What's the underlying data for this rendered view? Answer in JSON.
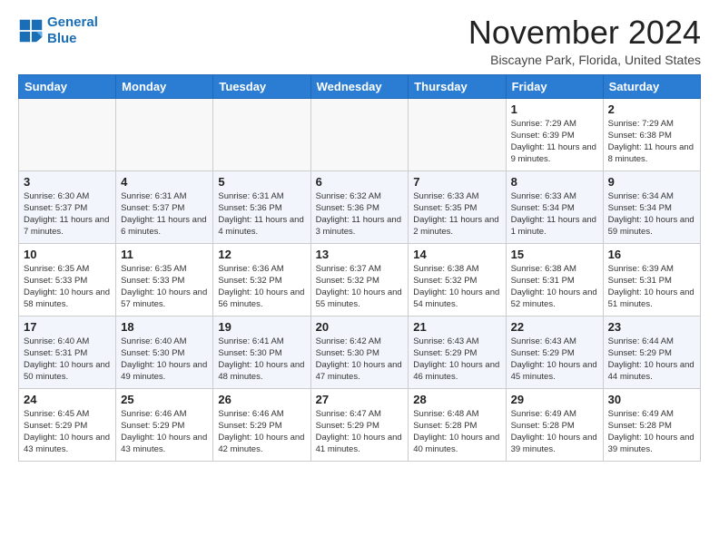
{
  "header": {
    "logo_line1": "General",
    "logo_line2": "Blue",
    "month": "November 2024",
    "location": "Biscayne Park, Florida, United States"
  },
  "days_of_week": [
    "Sunday",
    "Monday",
    "Tuesday",
    "Wednesday",
    "Thursday",
    "Friday",
    "Saturday"
  ],
  "weeks": [
    [
      {
        "day": "",
        "info": ""
      },
      {
        "day": "",
        "info": ""
      },
      {
        "day": "",
        "info": ""
      },
      {
        "day": "",
        "info": ""
      },
      {
        "day": "",
        "info": ""
      },
      {
        "day": "1",
        "info": "Sunrise: 7:29 AM\nSunset: 6:39 PM\nDaylight: 11 hours and 9 minutes."
      },
      {
        "day": "2",
        "info": "Sunrise: 7:29 AM\nSunset: 6:38 PM\nDaylight: 11 hours and 8 minutes."
      }
    ],
    [
      {
        "day": "3",
        "info": "Sunrise: 6:30 AM\nSunset: 5:37 PM\nDaylight: 11 hours and 7 minutes."
      },
      {
        "day": "4",
        "info": "Sunrise: 6:31 AM\nSunset: 5:37 PM\nDaylight: 11 hours and 6 minutes."
      },
      {
        "day": "5",
        "info": "Sunrise: 6:31 AM\nSunset: 5:36 PM\nDaylight: 11 hours and 4 minutes."
      },
      {
        "day": "6",
        "info": "Sunrise: 6:32 AM\nSunset: 5:36 PM\nDaylight: 11 hours and 3 minutes."
      },
      {
        "day": "7",
        "info": "Sunrise: 6:33 AM\nSunset: 5:35 PM\nDaylight: 11 hours and 2 minutes."
      },
      {
        "day": "8",
        "info": "Sunrise: 6:33 AM\nSunset: 5:34 PM\nDaylight: 11 hours and 1 minute."
      },
      {
        "day": "9",
        "info": "Sunrise: 6:34 AM\nSunset: 5:34 PM\nDaylight: 10 hours and 59 minutes."
      }
    ],
    [
      {
        "day": "10",
        "info": "Sunrise: 6:35 AM\nSunset: 5:33 PM\nDaylight: 10 hours and 58 minutes."
      },
      {
        "day": "11",
        "info": "Sunrise: 6:35 AM\nSunset: 5:33 PM\nDaylight: 10 hours and 57 minutes."
      },
      {
        "day": "12",
        "info": "Sunrise: 6:36 AM\nSunset: 5:32 PM\nDaylight: 10 hours and 56 minutes."
      },
      {
        "day": "13",
        "info": "Sunrise: 6:37 AM\nSunset: 5:32 PM\nDaylight: 10 hours and 55 minutes."
      },
      {
        "day": "14",
        "info": "Sunrise: 6:38 AM\nSunset: 5:32 PM\nDaylight: 10 hours and 54 minutes."
      },
      {
        "day": "15",
        "info": "Sunrise: 6:38 AM\nSunset: 5:31 PM\nDaylight: 10 hours and 52 minutes."
      },
      {
        "day": "16",
        "info": "Sunrise: 6:39 AM\nSunset: 5:31 PM\nDaylight: 10 hours and 51 minutes."
      }
    ],
    [
      {
        "day": "17",
        "info": "Sunrise: 6:40 AM\nSunset: 5:31 PM\nDaylight: 10 hours and 50 minutes."
      },
      {
        "day": "18",
        "info": "Sunrise: 6:40 AM\nSunset: 5:30 PM\nDaylight: 10 hours and 49 minutes."
      },
      {
        "day": "19",
        "info": "Sunrise: 6:41 AM\nSunset: 5:30 PM\nDaylight: 10 hours and 48 minutes."
      },
      {
        "day": "20",
        "info": "Sunrise: 6:42 AM\nSunset: 5:30 PM\nDaylight: 10 hours and 47 minutes."
      },
      {
        "day": "21",
        "info": "Sunrise: 6:43 AM\nSunset: 5:29 PM\nDaylight: 10 hours and 46 minutes."
      },
      {
        "day": "22",
        "info": "Sunrise: 6:43 AM\nSunset: 5:29 PM\nDaylight: 10 hours and 45 minutes."
      },
      {
        "day": "23",
        "info": "Sunrise: 6:44 AM\nSunset: 5:29 PM\nDaylight: 10 hours and 44 minutes."
      }
    ],
    [
      {
        "day": "24",
        "info": "Sunrise: 6:45 AM\nSunset: 5:29 PM\nDaylight: 10 hours and 43 minutes."
      },
      {
        "day": "25",
        "info": "Sunrise: 6:46 AM\nSunset: 5:29 PM\nDaylight: 10 hours and 43 minutes."
      },
      {
        "day": "26",
        "info": "Sunrise: 6:46 AM\nSunset: 5:29 PM\nDaylight: 10 hours and 42 minutes."
      },
      {
        "day": "27",
        "info": "Sunrise: 6:47 AM\nSunset: 5:29 PM\nDaylight: 10 hours and 41 minutes."
      },
      {
        "day": "28",
        "info": "Sunrise: 6:48 AM\nSunset: 5:28 PM\nDaylight: 10 hours and 40 minutes."
      },
      {
        "day": "29",
        "info": "Sunrise: 6:49 AM\nSunset: 5:28 PM\nDaylight: 10 hours and 39 minutes."
      },
      {
        "day": "30",
        "info": "Sunrise: 6:49 AM\nSunset: 5:28 PM\nDaylight: 10 hours and 39 minutes."
      }
    ]
  ]
}
